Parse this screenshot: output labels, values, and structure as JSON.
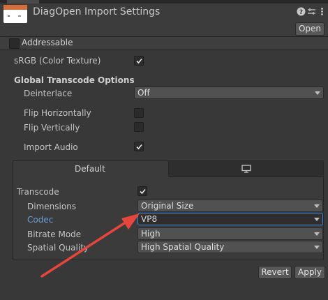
{
  "header": {
    "title": "DiagOpen Import Settings",
    "open_label": "Open",
    "icons": [
      "help-icon",
      "presets-icon",
      "more-menu-icon"
    ]
  },
  "addressable": {
    "label": "Addressable",
    "checked": false
  },
  "srgb": {
    "label": "sRGB (Color Texture)",
    "checked": true
  },
  "global": {
    "heading": "Global Transcode Options",
    "deinterlace_label": "Deinterlace",
    "deinterlace_value": "Off",
    "flip_h_label": "Flip Horizontally",
    "flip_h_checked": false,
    "flip_v_label": "Flip Vertically",
    "flip_v_checked": false,
    "import_audio_label": "Import Audio",
    "import_audio_checked": true
  },
  "platform": {
    "tabs": [
      {
        "label": "Default",
        "selected": true
      },
      {
        "label": "",
        "icon": "monitor-icon",
        "selected": false
      }
    ],
    "transcode_label": "Transcode",
    "transcode_checked": true,
    "rows": [
      {
        "label": "Dimensions",
        "value": "Original Size"
      },
      {
        "label": "Codec",
        "value": "VP8"
      },
      {
        "label": "Bitrate Mode",
        "value": "High"
      },
      {
        "label": "Spatial Quality",
        "value": "High Spatial Quality"
      }
    ]
  },
  "footer": {
    "revert_label": "Revert",
    "apply_label": "Apply"
  },
  "annotation": {
    "arrow_color": "#e8453c"
  },
  "colors": {
    "accent": "#3d86d8",
    "codec_label": "#6e9ddb"
  }
}
